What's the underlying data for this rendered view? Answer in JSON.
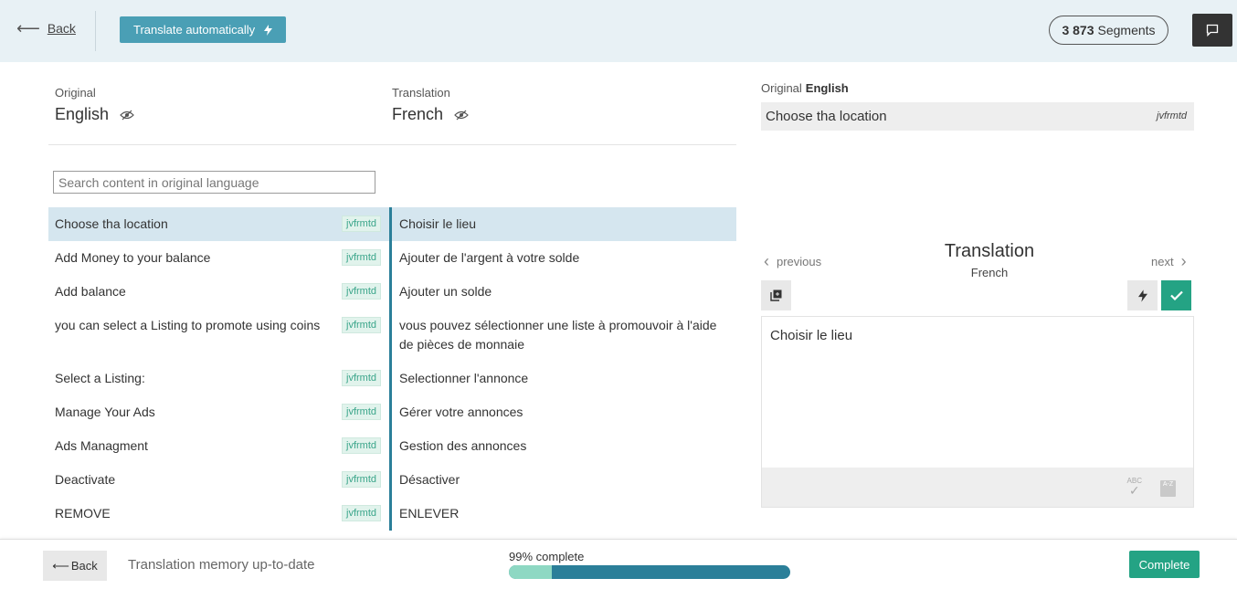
{
  "header": {
    "back_label": "Back",
    "translate_auto_label": "Translate automatically",
    "segments_count": "3 873",
    "segments_label": "Segments"
  },
  "languages": {
    "original_caption": "Original",
    "original_name": "English",
    "translation_caption": "Translation",
    "translation_name": "French"
  },
  "search": {
    "placeholder": "Search content in original language"
  },
  "segments": [
    {
      "source": "Choose tha location",
      "tag": "jvfrmtd",
      "target": "Choisir le lieu"
    },
    {
      "source": "Add Money to your balance",
      "tag": "jvfrmtd",
      "target": "Ajouter de l'argent à votre solde"
    },
    {
      "source": "Add balance",
      "tag": "jvfrmtd",
      "target": "Ajouter un solde"
    },
    {
      "source": "you can select a Listing to promote using coins",
      "tag": "jvfrmtd",
      "target": "vous pouvez sélectionner une liste à promouvoir à l'aide de pièces de monnaie"
    },
    {
      "source": "Select a Listing:",
      "tag": "jvfrmtd",
      "target": "Selectionner l'annonce"
    },
    {
      "source": "Manage Your Ads",
      "tag": "jvfrmtd",
      "target": "Gérer votre annonces"
    },
    {
      "source": "Ads Managment",
      "tag": "jvfrmtd",
      "target": "Gestion des annonces"
    },
    {
      "source": "Deactivate",
      "tag": "jvfrmtd",
      "target": "Désactiver"
    },
    {
      "source": "REMOVE",
      "tag": "jvfrmtd",
      "target": "ENLEVER"
    }
  ],
  "detail": {
    "original_caption": "Original",
    "original_lang": "English",
    "original_text": "Choose tha location",
    "original_tag": "jvfrmtd",
    "prev_label": "previous",
    "next_label": "next",
    "title": "Translation",
    "subtitle": "French",
    "editor_text": "Choisir le lieu",
    "spell_icon_text": "ABC",
    "az_icon_text": "A-Z"
  },
  "footer": {
    "back_label": "Back",
    "status": "Translation memory up-to-date",
    "progress_label": "99% complete",
    "progress_value": 0.99,
    "complete_label": "Complete"
  },
  "colors": {
    "topbar_bg": "#e8f1f5",
    "accent_blue": "#4a9fb5",
    "active_row": "#d5e6ef",
    "target_rule": "#2b7f99",
    "confirm_green": "#24a384",
    "progress_light": "#8ed8c3"
  }
}
